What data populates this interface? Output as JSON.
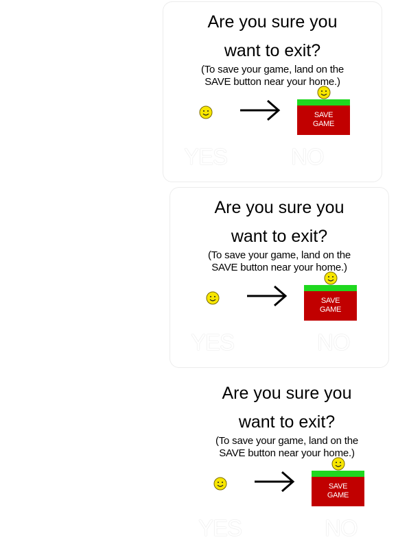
{
  "dialogs": [
    {
      "title_line1": "Are you sure you",
      "title_line2": "want to exit?",
      "note_line1": "(To save your game, land on the",
      "note_line2": "SAVE button near your home.)",
      "save_label_line1": "SAVE",
      "save_label_line2": "GAME",
      "yes_label": "YES",
      "no_label": "NO"
    },
    {
      "title_line1": "Are you sure you",
      "title_line2": "want to exit?",
      "note_line1": "(To save your game, land on the",
      "note_line2": "SAVE button near your home.)",
      "save_label_line1": "SAVE",
      "save_label_line2": "GAME",
      "yes_label": "YES",
      "no_label": "NO"
    },
    {
      "title_line1": "Are you sure you",
      "title_line2": "want to exit?",
      "note_line1": "(To save your game, land on the",
      "note_line2": "SAVE button near your home.)",
      "save_label_line1": "SAVE",
      "save_label_line2": "GAME",
      "yes_label": "YES",
      "no_label": "NO"
    }
  ],
  "colors": {
    "background": "#ffffff",
    "save_green": "#1fd81f",
    "save_red": "#c10000",
    "smiley_yellow": "#f7e600",
    "button_text": "#ffffff"
  },
  "icons": [
    "smiley-icon",
    "arrow-right-icon"
  ]
}
